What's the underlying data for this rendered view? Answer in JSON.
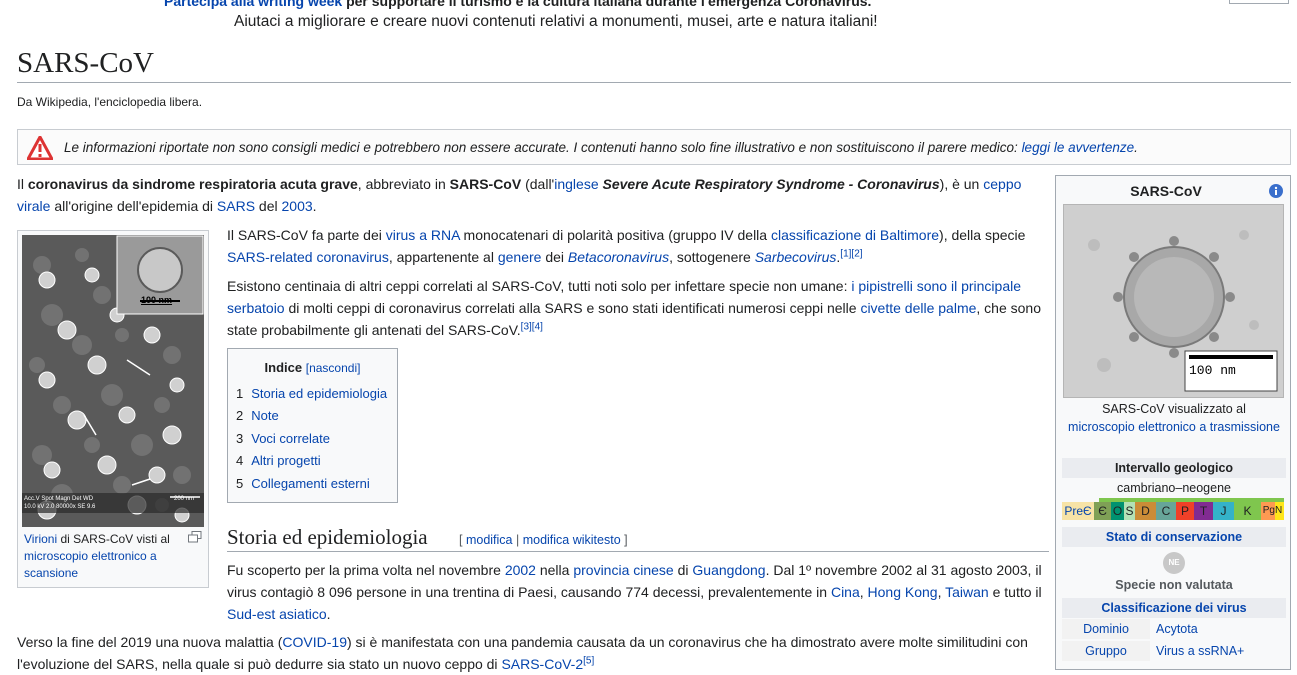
{
  "notice": {
    "line1_link": "Partecipa alla writing week",
    "line1_text": "per supportare il turismo e la cultura italiana durante l'emergenza Coronavirus.",
    "line2": "Aiutaci a migliorare e creare nuovi contenuti relativi a monumenti, musei, arte e natura italiani!"
  },
  "page": {
    "title": "SARS-CoV",
    "from": "Da Wikipedia, l'enciclopedia libera."
  },
  "disclaimer": {
    "text": "Le informazioni riportate non sono consigli medici e potrebbero non essere accurate. I contenuti hanno solo fine illustrativo e non sostituiscono il parere medico:",
    "link": "leggi le avvertenze",
    "end": "."
  },
  "intro": {
    "p1": {
      "t1": "Il ",
      "b1": "coronavirus da sindrome respiratoria acuta grave",
      "t2": ", abbreviato in ",
      "b2": "SARS-CoV",
      "t3": " (dall'",
      "l1": "inglese",
      "t4": " ",
      "bi": "Severe Acute Respiratory Syndrome - Coronavirus",
      "t5": "), è un ",
      "l2": "ceppo",
      "l3": "virale",
      "t6": " all'origine dell'epidemia di ",
      "l4": "SARS",
      "t7": " del ",
      "l5": "2003",
      "t8": "."
    },
    "p2": {
      "t1": "Il SARS-CoV fa parte dei ",
      "l1": "virus a RNA",
      "t2": " monocatenari di polarità positiva (gruppo IV della ",
      "l2": "classificazione di Baltimore",
      "t3": "), della specie",
      "l3": "SARS-related coronavirus",
      "t4": ", appartenente al ",
      "l4": "genere",
      "t5": " dei ",
      "l5": "Betacoronavirus",
      "t6": ", sottogenere ",
      "l6": "Sarbecovirus",
      "t7": ".",
      "ref": "[1][2]"
    },
    "p3": {
      "t1": "Esistono centinaia di altri ceppi correlati al SARS-CoV, tutti noti solo per infettare specie non umane: ",
      "l1": "i pipistrelli sono il principale",
      "l2": "serbatoio",
      "t2": " di molti ceppi di coronavirus correlati alla SARS e sono stati identificati numerosi ceppi nelle ",
      "l3": "civette delle palme",
      "t3": ", che sono",
      "t4": "state probabilmente gli antenati del SARS-CoV.",
      "ref": "[3][4]"
    }
  },
  "figure": {
    "scale": "100 nm",
    "meta": "Acc.V  Spot Magn    Det  WD",
    "meta2": "10.0 kV 2.0  80000x  SE  9.6",
    "scale2": "200 nm",
    "cap_l1": "Virioni",
    "cap_t1": " di SARS-CoV visti al ",
    "cap_l2": "microscopio elettronico a scansione"
  },
  "toc": {
    "title": "Indice",
    "toggle": "[nascondi]",
    "items": [
      {
        "num": "1",
        "label": "Storia ed epidemiologia"
      },
      {
        "num": "2",
        "label": "Note"
      },
      {
        "num": "3",
        "label": "Voci correlate"
      },
      {
        "num": "4",
        "label": "Altri progetti"
      },
      {
        "num": "5",
        "label": "Collegamenti esterni"
      }
    ]
  },
  "section": {
    "heading": "Storia ed epidemiologia",
    "edit_open": "[ ",
    "edit1": "modifica",
    "sep": " | ",
    "edit2": "modifica wikitesto",
    "edit_close": " ]"
  },
  "history": {
    "t1": "Fu scoperto per la prima volta nel novembre ",
    "l1": "2002",
    "t2": " nella ",
    "l2": "provincia cinese",
    "t3": " di ",
    "l3": "Guangdong",
    "t4": ". Dal 1º novembre 2002 al 31 agosto 2003, il",
    "t5": "virus contagiò 8 096 persone in una trentina di Paesi, causando 774 decessi, prevalentemente in ",
    "l4": "Cina",
    "c1": ", ",
    "l5": "Hong Kong",
    "c2": ", ",
    "l6": "Taiwan",
    "t6": " e tutto il",
    "l7": "Sud-est asiatico",
    "t7": "."
  },
  "covid": {
    "t1": "Verso la fine del 2019 una nuova malattia (",
    "l1": "COVID-19",
    "t2": ") si è manifestata con una pandemia causata da un coronavirus che ha dimostrato avere molte similitudini con",
    "t3": "l'evoluzione del SARS, nella quale si può dedurre sia stato un nuovo ceppo di ",
    "l2": "SARS-CoV-2",
    "ref": "[5]"
  },
  "infobox": {
    "title": "SARS-CoV",
    "scale": "100 nm",
    "cap_t": "SARS-CoV visualizzato al",
    "cap_l": "microscopio elettronico a trasmissione",
    "geo_head": "Intervallo geologico",
    "geo_range": "cambriano–neogene",
    "geo_periods": [
      {
        "label": "PreЄ",
        "color": "#f7e3a6"
      },
      {
        "label": "Є",
        "color": "#7fa056"
      },
      {
        "label": "O",
        "color": "#009270"
      },
      {
        "label": "S",
        "color": "#b3e1b6"
      },
      {
        "label": "D",
        "color": "#cb8c37"
      },
      {
        "label": "C",
        "color": "#67a599"
      },
      {
        "label": "P",
        "color": "#f04028"
      },
      {
        "label": "T",
        "color": "#812b92"
      },
      {
        "label": "J",
        "color": "#34b2c9"
      },
      {
        "label": "K",
        "color": "#7fc64e"
      },
      {
        "label": "Pg",
        "color": "#fd9a52"
      },
      {
        "label": "N",
        "color": "#ffe619"
      }
    ],
    "range_bar_color": "#7fc64e",
    "cons_head": "Stato di conservazione",
    "cons_icon": "NE",
    "cons_text": "Specie non valutata",
    "class_head": "Classificazione dei virus",
    "rows": [
      {
        "k": "Dominio",
        "v": "Acytota"
      },
      {
        "k": "Gruppo",
        "v": "Virus a ssRNA+"
      }
    ]
  }
}
